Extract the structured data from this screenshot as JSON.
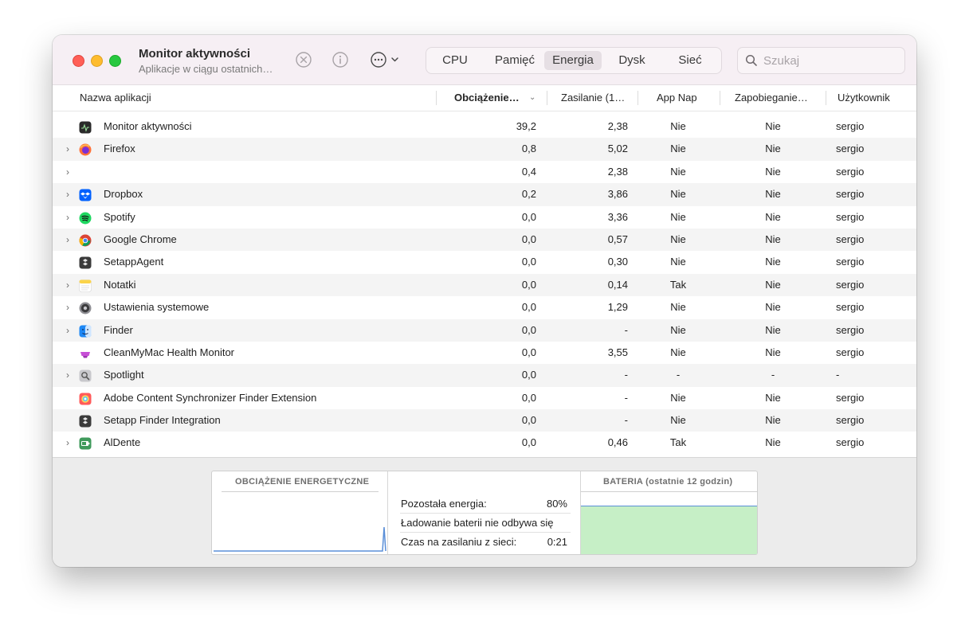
{
  "window": {
    "title": "Monitor aktywności",
    "subtitle": "Aplikacje w ciągu ostatnich…"
  },
  "toolbar": {
    "stop_icon": "x-circle-icon",
    "info_icon": "info-circle-icon",
    "more_icon": "ellipsis-circle-icon",
    "tabs": [
      {
        "label": "CPU",
        "active": false
      },
      {
        "label": "Pamięć",
        "active": false
      },
      {
        "label": "Energia",
        "active": true
      },
      {
        "label": "Dysk",
        "active": false
      },
      {
        "label": "Sieć",
        "active": false
      }
    ],
    "search_placeholder": "Szukaj"
  },
  "columns": {
    "name": "Nazwa aplikacji",
    "load": "Obciążenie…",
    "power": "Zasilanie (1…",
    "app_nap": "App Nap",
    "preventing": "Zapobieganie…",
    "user": "Użytkownik"
  },
  "rows": [
    {
      "name": "Monitor aktywności",
      "expandable": false,
      "icon": "activity-monitor-icon",
      "load": "39,2",
      "power": "2,38",
      "app_nap": "Nie",
      "preventing": "Nie",
      "user": "sergio"
    },
    {
      "name": "Firefox",
      "expandable": true,
      "icon": "firefox-icon",
      "load": "0,8",
      "power": "5,02",
      "app_nap": "Nie",
      "preventing": "Nie",
      "user": "sergio"
    },
    {
      "name": "",
      "expandable": true,
      "icon": "",
      "load": "0,4",
      "power": "2,38",
      "app_nap": "Nie",
      "preventing": "Nie",
      "user": "sergio"
    },
    {
      "name": "Dropbox",
      "expandable": true,
      "icon": "dropbox-icon",
      "load": "0,2",
      "power": "3,86",
      "app_nap": "Nie",
      "preventing": "Nie",
      "user": "sergio"
    },
    {
      "name": "Spotify",
      "expandable": true,
      "icon": "spotify-icon",
      "load": "0,0",
      "power": "3,36",
      "app_nap": "Nie",
      "preventing": "Nie",
      "user": "sergio"
    },
    {
      "name": "Google Chrome",
      "expandable": true,
      "icon": "chrome-icon",
      "load": "0,0",
      "power": "0,57",
      "app_nap": "Nie",
      "preventing": "Nie",
      "user": "sergio"
    },
    {
      "name": "SetappAgent",
      "expandable": false,
      "icon": "setapp-icon",
      "load": "0,0",
      "power": "0,30",
      "app_nap": "Nie",
      "preventing": "Nie",
      "user": "sergio"
    },
    {
      "name": "Notatki",
      "expandable": true,
      "icon": "notes-icon",
      "load": "0,0",
      "power": "0,14",
      "app_nap": "Tak",
      "preventing": "Nie",
      "user": "sergio"
    },
    {
      "name": "Ustawienia systemowe",
      "expandable": true,
      "icon": "settings-gear-icon",
      "load": "0,0",
      "power": "1,29",
      "app_nap": "Nie",
      "preventing": "Nie",
      "user": "sergio"
    },
    {
      "name": "Finder",
      "expandable": true,
      "icon": "finder-icon",
      "load": "0,0",
      "power": "-",
      "app_nap": "Nie",
      "preventing": "Nie",
      "user": "sergio"
    },
    {
      "name": "CleanMyMac Health Monitor",
      "expandable": false,
      "icon": "cleanmymac-icon",
      "load": "0,0",
      "power": "3,55",
      "app_nap": "Nie",
      "preventing": "Nie",
      "user": "sergio"
    },
    {
      "name": "Spotlight",
      "expandable": true,
      "icon": "spotlight-icon",
      "load": "0,0",
      "power": "-",
      "app_nap": "-",
      "preventing": "-",
      "user": "-"
    },
    {
      "name": "Adobe Content Synchronizer Finder Extension",
      "expandable": false,
      "icon": "adobe-creative-cloud-icon",
      "load": "0,0",
      "power": "-",
      "app_nap": "Nie",
      "preventing": "Nie",
      "user": "sergio"
    },
    {
      "name": "Setapp Finder Integration",
      "expandable": false,
      "icon": "setapp-icon",
      "load": "0,0",
      "power": "-",
      "app_nap": "Nie",
      "preventing": "Nie",
      "user": "sergio"
    },
    {
      "name": "AlDente",
      "expandable": true,
      "icon": "aldente-icon",
      "load": "0,0",
      "power": "0,46",
      "app_nap": "Tak",
      "preventing": "Nie",
      "user": "sergio"
    }
  ],
  "bottom_panel": {
    "energy_title": "OBCIĄŻENIE ENERGETYCZNE",
    "battery_title": "BATERIA (ostatnie 12 godzin)",
    "remaining_label": "Pozostała energia:",
    "remaining_value": "80%",
    "charging_status": "Ładowanie baterii nie odbywa się",
    "on_power_label": "Czas na zasilaniu z sieci:",
    "on_power_value": "0:21",
    "battery_level": 0.8,
    "battery_color": "#c6efc6",
    "battery_line_color": "#5a8fd8"
  },
  "colors": {
    "titlebar": "#f6eff4",
    "close": "#ff5f57",
    "minimize": "#febc2e",
    "zoom": "#28c840",
    "row_alt": "#f4f4f4"
  }
}
